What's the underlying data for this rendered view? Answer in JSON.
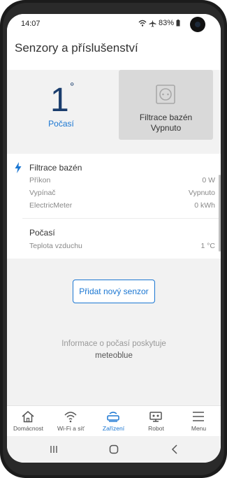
{
  "status": {
    "time": "14:07",
    "battery": "83%"
  },
  "appbar": {
    "title": "Senzory a příslušenství"
  },
  "tiles": {
    "weather": {
      "value": "1",
      "degree": "°",
      "label": "Počasí"
    },
    "socket": {
      "line1": "Filtrace bazén",
      "line2": "Vypnuto"
    }
  },
  "sections": [
    {
      "title": "Filtrace bazén",
      "rows": [
        {
          "label": "Příkon",
          "value": "0 W"
        },
        {
          "label": "Vypínač",
          "value": "Vypnuto"
        },
        {
          "label": "ElectricMeter",
          "value": "0 kWh"
        }
      ]
    },
    {
      "title": "Počasí",
      "rows": [
        {
          "label": "Teplota vzduchu",
          "value": "1 °C"
        }
      ]
    }
  ],
  "add_button": "Přidat nový senzor",
  "info": {
    "text": "Informace o počasí poskytuje",
    "brand": "meteoblue"
  },
  "tabs": [
    {
      "label": "Domácnost",
      "icon": "home-icon"
    },
    {
      "label": "Wi-Fi a síť",
      "icon": "wifi-icon"
    },
    {
      "label": "Zařízení",
      "icon": "router-icon"
    },
    {
      "label": "Robot",
      "icon": "robot-icon"
    },
    {
      "label": "Menu",
      "icon": "menu-icon"
    }
  ],
  "colors": {
    "accent": "#1a76d2",
    "temperature": "#1a3d6d"
  }
}
